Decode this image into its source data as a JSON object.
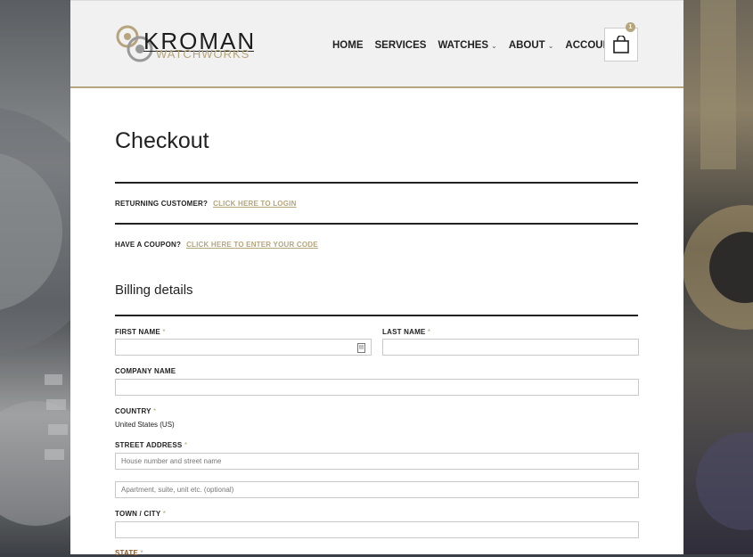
{
  "brand": {
    "name": "KROMAN",
    "sub": "WATCHWORKS"
  },
  "nav": [
    {
      "label": "HOME",
      "dropdown": false
    },
    {
      "label": "SERVICES",
      "dropdown": false
    },
    {
      "label": "WATCHES",
      "dropdown": true
    },
    {
      "label": "ABOUT",
      "dropdown": true
    },
    {
      "label": "ACCOUNT",
      "dropdown": true
    }
  ],
  "cart": {
    "count": "1"
  },
  "page_title": "Checkout",
  "notices": {
    "returning": "RETURNING CUSTOMER?",
    "login_link": "CLICK HERE TO LOGIN",
    "coupon": "HAVE A COUPON?",
    "coupon_link": "CLICK HERE TO ENTER YOUR CODE"
  },
  "billing": {
    "title": "Billing details",
    "first_name": "FIRST NAME",
    "last_name": "LAST NAME",
    "company": "COMPANY NAME",
    "country": "COUNTRY",
    "country_value": "United States (US)",
    "street": "STREET ADDRESS",
    "street_placeholder": "House number and street name",
    "street2_placeholder": "Apartment, suite, unit etc. (optional)",
    "city": "TOWN / CITY",
    "state": "STATE",
    "required": "*"
  },
  "colors": {
    "accent": "#b6a57c",
    "text": "#222222"
  }
}
